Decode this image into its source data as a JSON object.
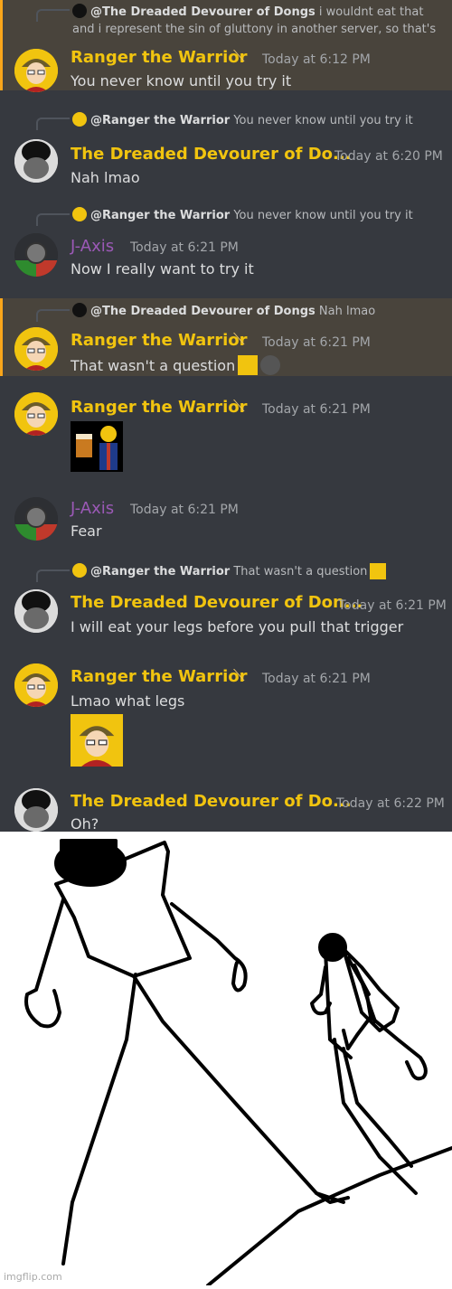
{
  "messages": [
    {
      "reply_mention": "@The Dreaded Devourer of Dongs",
      "reply_text": "i wouldnt eat that and i represent the sin of gluttony in another server, so that's"
    },
    {
      "author": "Ranger the Warrior",
      "time": "Today at 6:12 PM",
      "text": "You never know until you try it"
    },
    {
      "reply_mention": "@Ranger the Warrior",
      "reply_text": "You never know until you try it",
      "author": "The Dreaded Devourer of Do...",
      "time": "Today at 6:20 PM",
      "text": "Nah lmao"
    },
    {
      "reply_mention": "@Ranger the Warrior",
      "reply_text": "You never know until you try it",
      "author": "J-Axis",
      "time": "Today at 6:21 PM",
      "text": "Now I really want to try it"
    },
    {
      "reply_mention": "@The Dreaded Devourer of Dongs",
      "reply_text": "Nah lmao",
      "author": "Ranger the Warrior",
      "time": "Today at 6:21 PM",
      "text": "That wasn't a question"
    },
    {
      "author": "Ranger the Warrior",
      "time": "Today at 6:21 PM"
    },
    {
      "author": "J-Axis",
      "time": "Today at 6:21 PM",
      "text": "Fear"
    },
    {
      "reply_mention": "@Ranger the Warrior",
      "reply_text": "That wasn't a question",
      "author": "The Dreaded Devourer of Don...",
      "time": "Today at 6:21 PM",
      "text": "I will eat your legs before you pull that trigger"
    },
    {
      "author": "Ranger the Warrior",
      "time": "Today at 6:21 PM",
      "text": "Lmao what legs"
    },
    {
      "author": "The Dreaded Devourer of Do...",
      "time": "Today at 6:22 PM",
      "text": "Oh?"
    }
  ],
  "colors": {
    "ranger_name": "#f1c40f",
    "dreaded_name": "#f1c40f",
    "jaxis_name": "#9b59b6",
    "background": "#36393f",
    "highlight": "#49443c",
    "highlight_bar": "#faa61a"
  },
  "icons": {
    "role_badge": "sword-icon"
  },
  "meme": {
    "watermark": "imgflip.com"
  }
}
